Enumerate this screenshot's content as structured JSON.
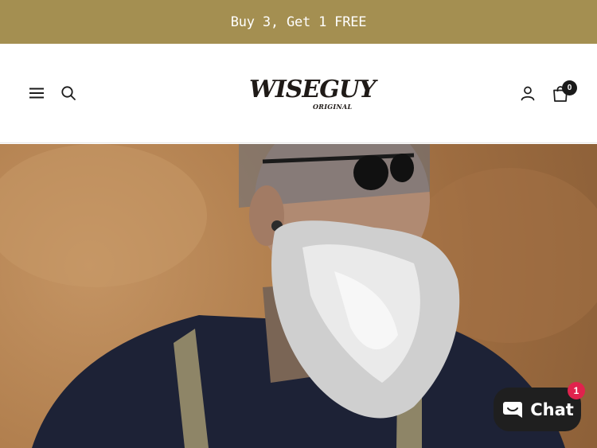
{
  "announcement": {
    "text": "Buy 3, Get 1 FREE"
  },
  "header": {
    "logo": {
      "wordmark": "WISEGUY",
      "tagline": "ORIGINAL"
    },
    "cart_count": "0",
    "icons": {
      "menu": "hamburger-menu-icon",
      "search": "search-icon",
      "account": "user-icon",
      "cart": "shopping-bag-icon"
    }
  },
  "hero": {
    "image_subject": "bearded man with sunglasses and suspenders"
  },
  "chat": {
    "label": "Chat",
    "unread": "1",
    "icon": "chat-bubble-icon"
  },
  "colors": {
    "announcement_bg": "#a48f51",
    "announcement_text": "#ffffff",
    "chat_bg": "#1f1f1f",
    "chat_badge": "#e0234d",
    "hero_bg": "#b2804f"
  }
}
